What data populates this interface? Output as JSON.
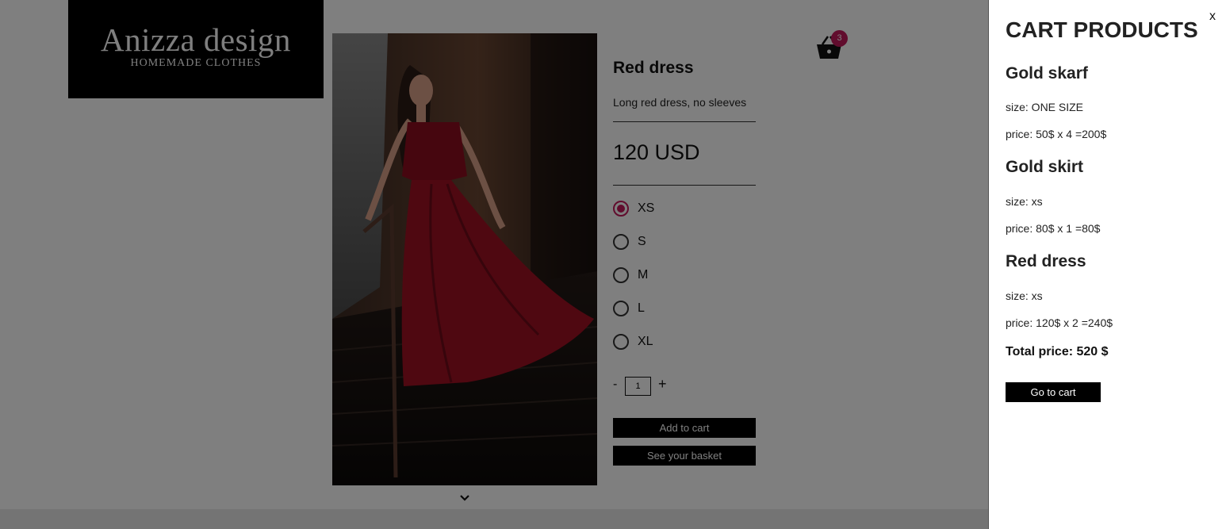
{
  "brand": {
    "name": "Anizza design",
    "tagline": "HOMEMADE CLOTHES"
  },
  "product": {
    "title": "Red dress",
    "description": "Long red dress, no sleeves",
    "price": "120 USD",
    "sizes": [
      {
        "label": "XS",
        "selected": true
      },
      {
        "label": "S",
        "selected": false
      },
      {
        "label": "M",
        "selected": false
      },
      {
        "label": "L",
        "selected": false
      },
      {
        "label": "XL",
        "selected": false
      }
    ],
    "quantity": {
      "minus": "-",
      "value": "1",
      "plus": "+"
    },
    "add_to_cart_label": "Add to cart",
    "see_basket_label": "See your basket"
  },
  "header": {
    "cart_count": "3",
    "cart_icon": "basket-icon"
  },
  "scroll_icon": "chevron-down-icon",
  "cart_drawer": {
    "close_label": "x",
    "title": "CART PRODUCTS",
    "items": [
      {
        "name": "Gold skarf",
        "size": "size: ONE SIZE",
        "price": "price: 50$ x 4 =200$"
      },
      {
        "name": "Gold skirt",
        "size": "size: xs",
        "price": "price: 80$ x 1 =80$"
      },
      {
        "name": "Red dress",
        "size": "size: xs",
        "price": "price: 120$ x 2 =240$"
      }
    ],
    "total": "Total price: 520 $",
    "go_to_cart_label": "Go to cart"
  },
  "colors": {
    "accent": "#c2185b",
    "button_bg": "#000000",
    "overlay": "rgba(0,0,0,0.5)",
    "dress": "#9e1022"
  }
}
